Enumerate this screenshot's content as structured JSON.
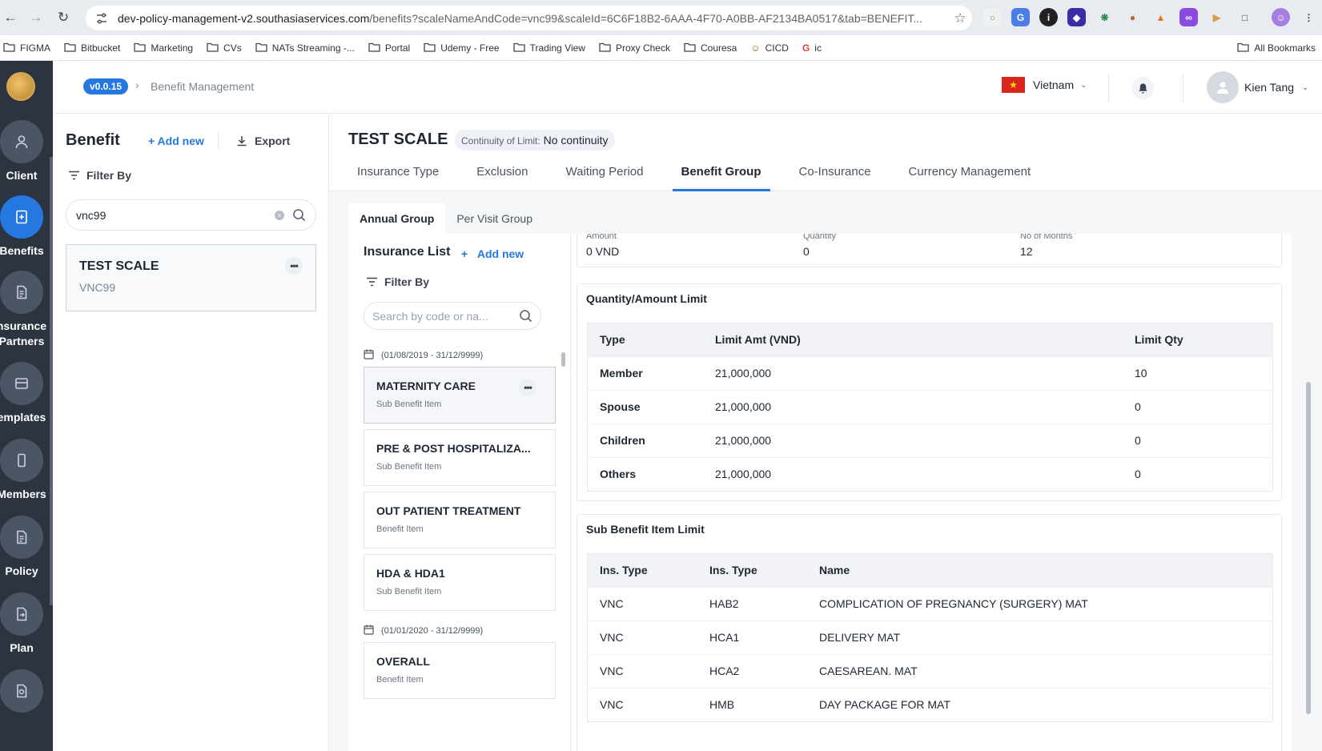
{
  "browser": {
    "url_host": "dev-policy-management-v2.southasiaservices.com",
    "url_rest": "/benefits?scaleNameAndCode=vnc99&scaleId=6C6F18B2-6AAA-4F70-A0BB-AF2134BA0517&tab=BENEFIT...",
    "bookmarks": [
      "FIGMA",
      "Bitbucket",
      "Marketing",
      "CVs",
      "NATs Streaming -...",
      "Portal",
      "Udemy - Free",
      "Trading View",
      "Proxy Check",
      "Couresa",
      "CICD",
      "ic"
    ],
    "all_bookmarks": "All Bookmarks"
  },
  "rail": {
    "items": [
      {
        "label": "Client",
        "icon": "person-icon"
      },
      {
        "label": "Benefits",
        "icon": "benefits-icon"
      },
      {
        "label": "nsurance",
        "label2": "Partners",
        "icon": "document-icon"
      },
      {
        "label": "emplates",
        "icon": "template-icon"
      },
      {
        "label": "Members",
        "icon": "phone-icon"
      },
      {
        "label": "Policy",
        "icon": "document-icon"
      },
      {
        "label": "Plan",
        "icon": "plan-icon"
      }
    ]
  },
  "header": {
    "version": "v0.0.15",
    "breadcrumb": "Benefit Management",
    "country": "Vietnam",
    "user": "Kien Tang"
  },
  "benefit_panel": {
    "title": "Benefit",
    "add_new": "+ Add new",
    "export": "Export",
    "filter_by": "Filter By",
    "search_value": "vnc99",
    "card": {
      "name": "TEST SCALE",
      "code": "VNC99"
    }
  },
  "main": {
    "title": "TEST SCALE",
    "continuity_label": "Continuity of Limit:",
    "continuity_value": "No continuity",
    "tabs": [
      "Insurance Type",
      "Exclusion",
      "Waiting Period",
      "Benefit Group",
      "Co-Insurance",
      "Currency Management"
    ],
    "sub_tabs": [
      "Annual Group",
      "Per Visit Group"
    ]
  },
  "insurance_list": {
    "title": "Insurance List",
    "add_new": "Add new",
    "filter_by": "Filter By",
    "search_placeholder": "Search by code or na...",
    "groups": [
      {
        "period": "(01/08/2019 - 31/12/9999)",
        "items": [
          {
            "name": "MATERNITY CARE",
            "type": "Sub Benefit Item"
          },
          {
            "name": "PRE & POST HOSPITALIZA...",
            "type": "Sub Benefit Item"
          },
          {
            "name": "OUT PATIENT TREATMENT",
            "type": "Benefit Item"
          },
          {
            "name": "HDA & HDA1",
            "type": "Sub Benefit Item"
          }
        ]
      },
      {
        "period": "(01/01/2020 - 31/12/9999)",
        "items": [
          {
            "name": "OVERALL",
            "type": "Benefit Item"
          }
        ]
      }
    ]
  },
  "detail": {
    "meta": [
      {
        "label": "Amount",
        "value": "0 VND"
      },
      {
        "label": "Quantity",
        "value": "0"
      },
      {
        "label": "No of Months",
        "value": "12"
      }
    ],
    "qty_amount_limit": {
      "title": "Quantity/Amount Limit",
      "headers": [
        "Type",
        "Limit Amt (VND)",
        "Limit Qty"
      ],
      "rows": [
        [
          "Member",
          "21,000,000",
          "10"
        ],
        [
          "Spouse",
          "21,000,000",
          "0"
        ],
        [
          "Children",
          "21,000,000",
          "0"
        ],
        [
          "Others",
          "21,000,000",
          "0"
        ]
      ]
    },
    "sub_benefit_limit": {
      "title": "Sub Benefit Item Limit",
      "headers": [
        "Ins. Type",
        "Ins. Type",
        "Name"
      ],
      "rows": [
        [
          "VNC",
          "HAB2",
          "COMPLICATION OF PREGNANCY (SURGERY) MAT"
        ],
        [
          "VNC",
          "HCA1",
          "DELIVERY MAT"
        ],
        [
          "VNC",
          "HCA2",
          "CAESAREAN. MAT"
        ],
        [
          "VNC",
          "HMB",
          "DAY PACKAGE FOR MAT"
        ]
      ]
    }
  },
  "colors": {
    "accent": "#2478e0",
    "rail": "#2c3440",
    "flag": "#da251d"
  }
}
